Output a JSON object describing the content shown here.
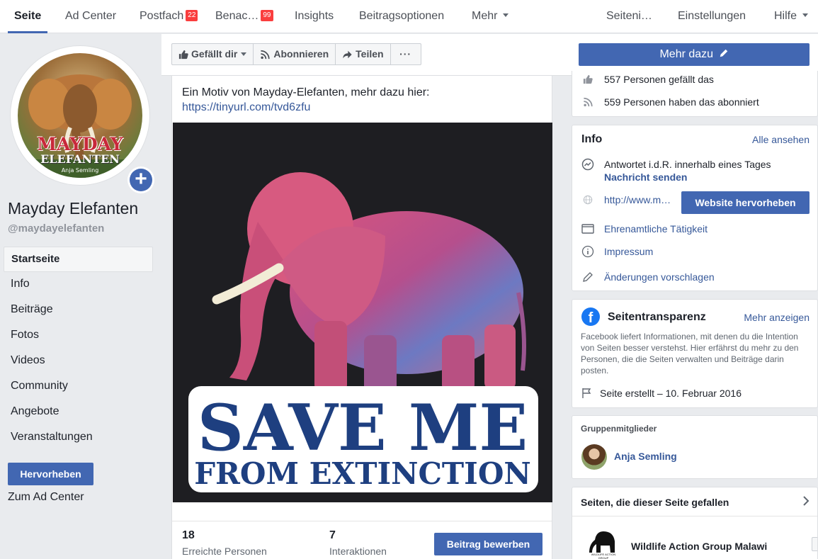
{
  "tabs": [
    {
      "label": "Seite"
    },
    {
      "label": "Ad Center"
    },
    {
      "label": "Postfach",
      "badge": "22"
    },
    {
      "label": "Benac…",
      "badge": "99"
    },
    {
      "label": "Insights"
    },
    {
      "label": "Beitragsoptionen"
    },
    {
      "label": "Mehr"
    },
    {
      "label": "Seiteni…"
    },
    {
      "label": "Einstellungen"
    },
    {
      "label": "Hilfe"
    }
  ],
  "profile": {
    "avatar_title": "MAYDAY",
    "avatar_subtitle": "ELEFANTEN",
    "avatar_author": "Anja Semling",
    "name": "Mayday Elefanten",
    "handle": "@maydayelefanten"
  },
  "nav": [
    {
      "label": "Startseite"
    },
    {
      "label": "Info"
    },
    {
      "label": "Beiträge"
    },
    {
      "label": "Fotos"
    },
    {
      "label": "Videos"
    },
    {
      "label": "Community"
    },
    {
      "label": "Angebote"
    },
    {
      "label": "Veranstaltungen"
    }
  ],
  "left_actions": {
    "promote": "Hervorheben",
    "ad_center": "Zum Ad Center"
  },
  "actions": {
    "like": "Gefällt dir",
    "follow": "Abonnieren",
    "share": "Teilen",
    "more": "···",
    "learn_more": "Mehr dazu"
  },
  "post": {
    "text": "Ein Motiv von Mayday-Elefanten, mehr dazu hier:",
    "link": "https://tinyurl.com/tvd6zfu",
    "image_line1": "SAVE ME",
    "image_line2": "FROM EXTINCTION",
    "reach_count": "18",
    "reach_label": "Erreichte Personen",
    "interactions_count": "7",
    "interactions_label": "Interaktionen",
    "boost": "Beitrag bewerben"
  },
  "community": {
    "likes": "557 Personen gefällt das",
    "follows": "559 Personen haben das abonniert"
  },
  "info": {
    "title": "Info",
    "see_all": "Alle ansehen",
    "response": "Antwortet i.d.R. innerhalb eines Tages",
    "send_message": "Nachricht senden",
    "website": "http://www.m…",
    "highlight_website": "Website hervorheben",
    "volunteer": "Ehrenamtliche Tätigkeit",
    "imprint": "Impressum",
    "suggest": "Änderungen vorschlagen"
  },
  "transparency": {
    "title": "Seitentransparenz",
    "more": "Mehr anzeigen",
    "desc": "Facebook liefert Informationen, mit denen du die Intention von Seiten besser verstehst. Hier erfährst du mehr zu den Personen, die die Seiten verwalten und Beiträge darin posten.",
    "created": "Seite erstellt – 10. Februar 2016"
  },
  "group": {
    "title": "Gruppenmitglieder",
    "member": "Anja Semling"
  },
  "liked_pages": {
    "title": "Seiten, die dieser Seite gefallen",
    "page_name": "Wildlife Action Group Malawi",
    "logo_text": "WILDLIFE ACTION GROUP"
  },
  "colors": {
    "brand": "#4267b2",
    "link": "#365899",
    "badge": "#fa3e3e"
  }
}
